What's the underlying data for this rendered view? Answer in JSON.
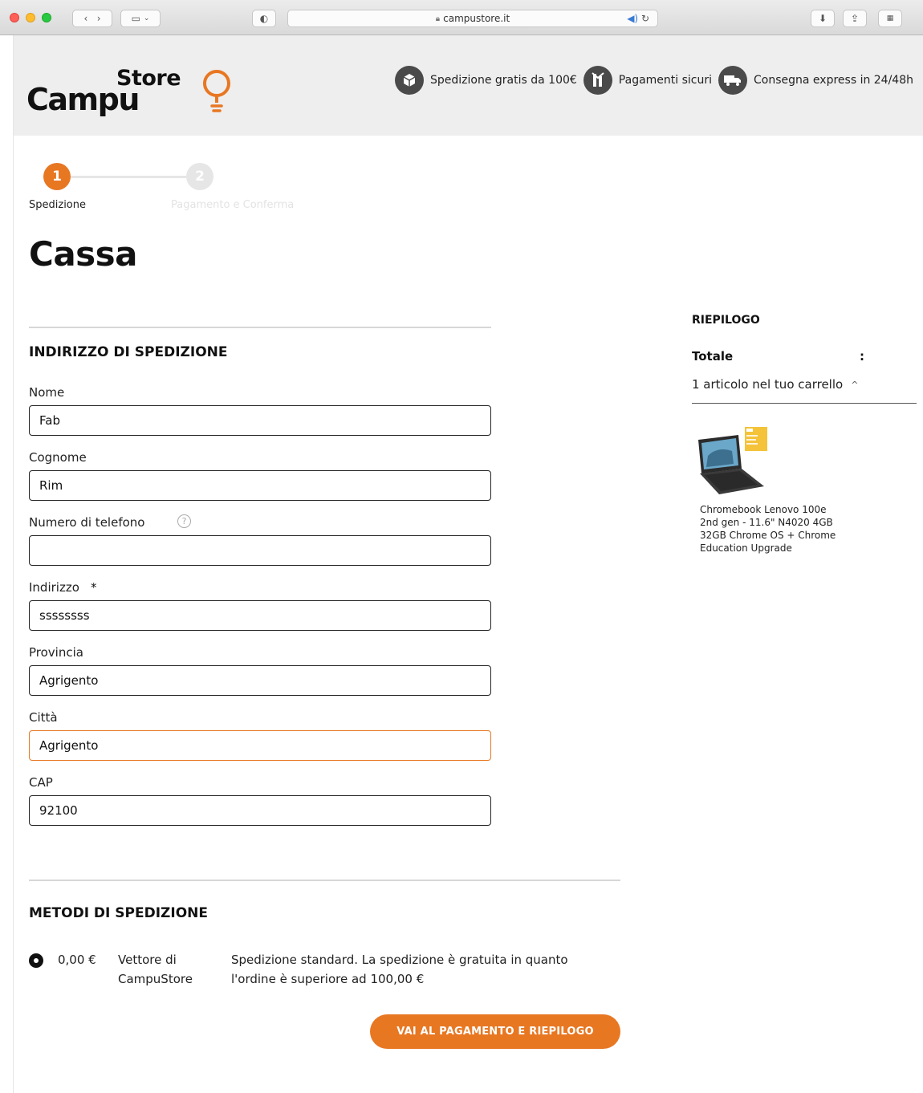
{
  "browser": {
    "url": "campustore.it"
  },
  "header": {
    "logo_campu": "Campu",
    "logo_store": "Store",
    "features": [
      {
        "icon": "box-icon",
        "label": "Spedizione gratis da 100€"
      },
      {
        "icon": "shield-icon",
        "label": "Pagamenti sicuri"
      },
      {
        "icon": "truck-icon",
        "label": "Consegna express in 24/48h"
      }
    ]
  },
  "stepper": {
    "steps": [
      {
        "number": "1",
        "label": "Spedizione",
        "active": true
      },
      {
        "number": "2",
        "label": "Pagamento e Conferma",
        "active": false
      }
    ]
  },
  "page_title": "Cassa",
  "shipping_address": {
    "title": "INDIRIZZO DI SPEDIZIONE",
    "fields": {
      "nome": {
        "label": "Nome",
        "value": "Fab"
      },
      "cognome": {
        "label": "Cognome",
        "value": "Rim"
      },
      "telefono": {
        "label": "Numero di telefono",
        "value": "",
        "help": "?"
      },
      "indirizzo": {
        "label": "Indirizzo",
        "value": "ssssssss",
        "required": "*"
      },
      "provincia": {
        "label": "Provincia",
        "value": "Agrigento"
      },
      "citta": {
        "label": "Città",
        "value": "Agrigento"
      },
      "cap": {
        "label": "CAP",
        "value": "92100"
      }
    }
  },
  "shipping_methods": {
    "title": "METODI DI SPEDIZIONE",
    "options": [
      {
        "price": "0,00 €",
        "carrier_line1": "Vettore di",
        "carrier_line2": "CampuStore",
        "desc_line1": "Spedizione standard. La spedizione è gratuita in quanto",
        "desc_line2": "l'ordine è superiore ad 100,00 €",
        "selected": true
      }
    ]
  },
  "cta_label": "VAI AL PAGAMENTO E RIEPILOGO",
  "summary": {
    "title": "RIEPILOGO",
    "total_label": "Totale",
    "total_value": ":",
    "items_label": "1 articolo nel tuo carrello",
    "product_line1": "Chromebook Lenovo 100e",
    "product_line2": "2nd gen - 11.6\" N4020 4GB",
    "product_line3": "32GB Chrome OS + Chrome",
    "product_line4": "Education Upgrade"
  },
  "colors": {
    "accent": "#e87722",
    "header_bg": "#eeeeee"
  }
}
